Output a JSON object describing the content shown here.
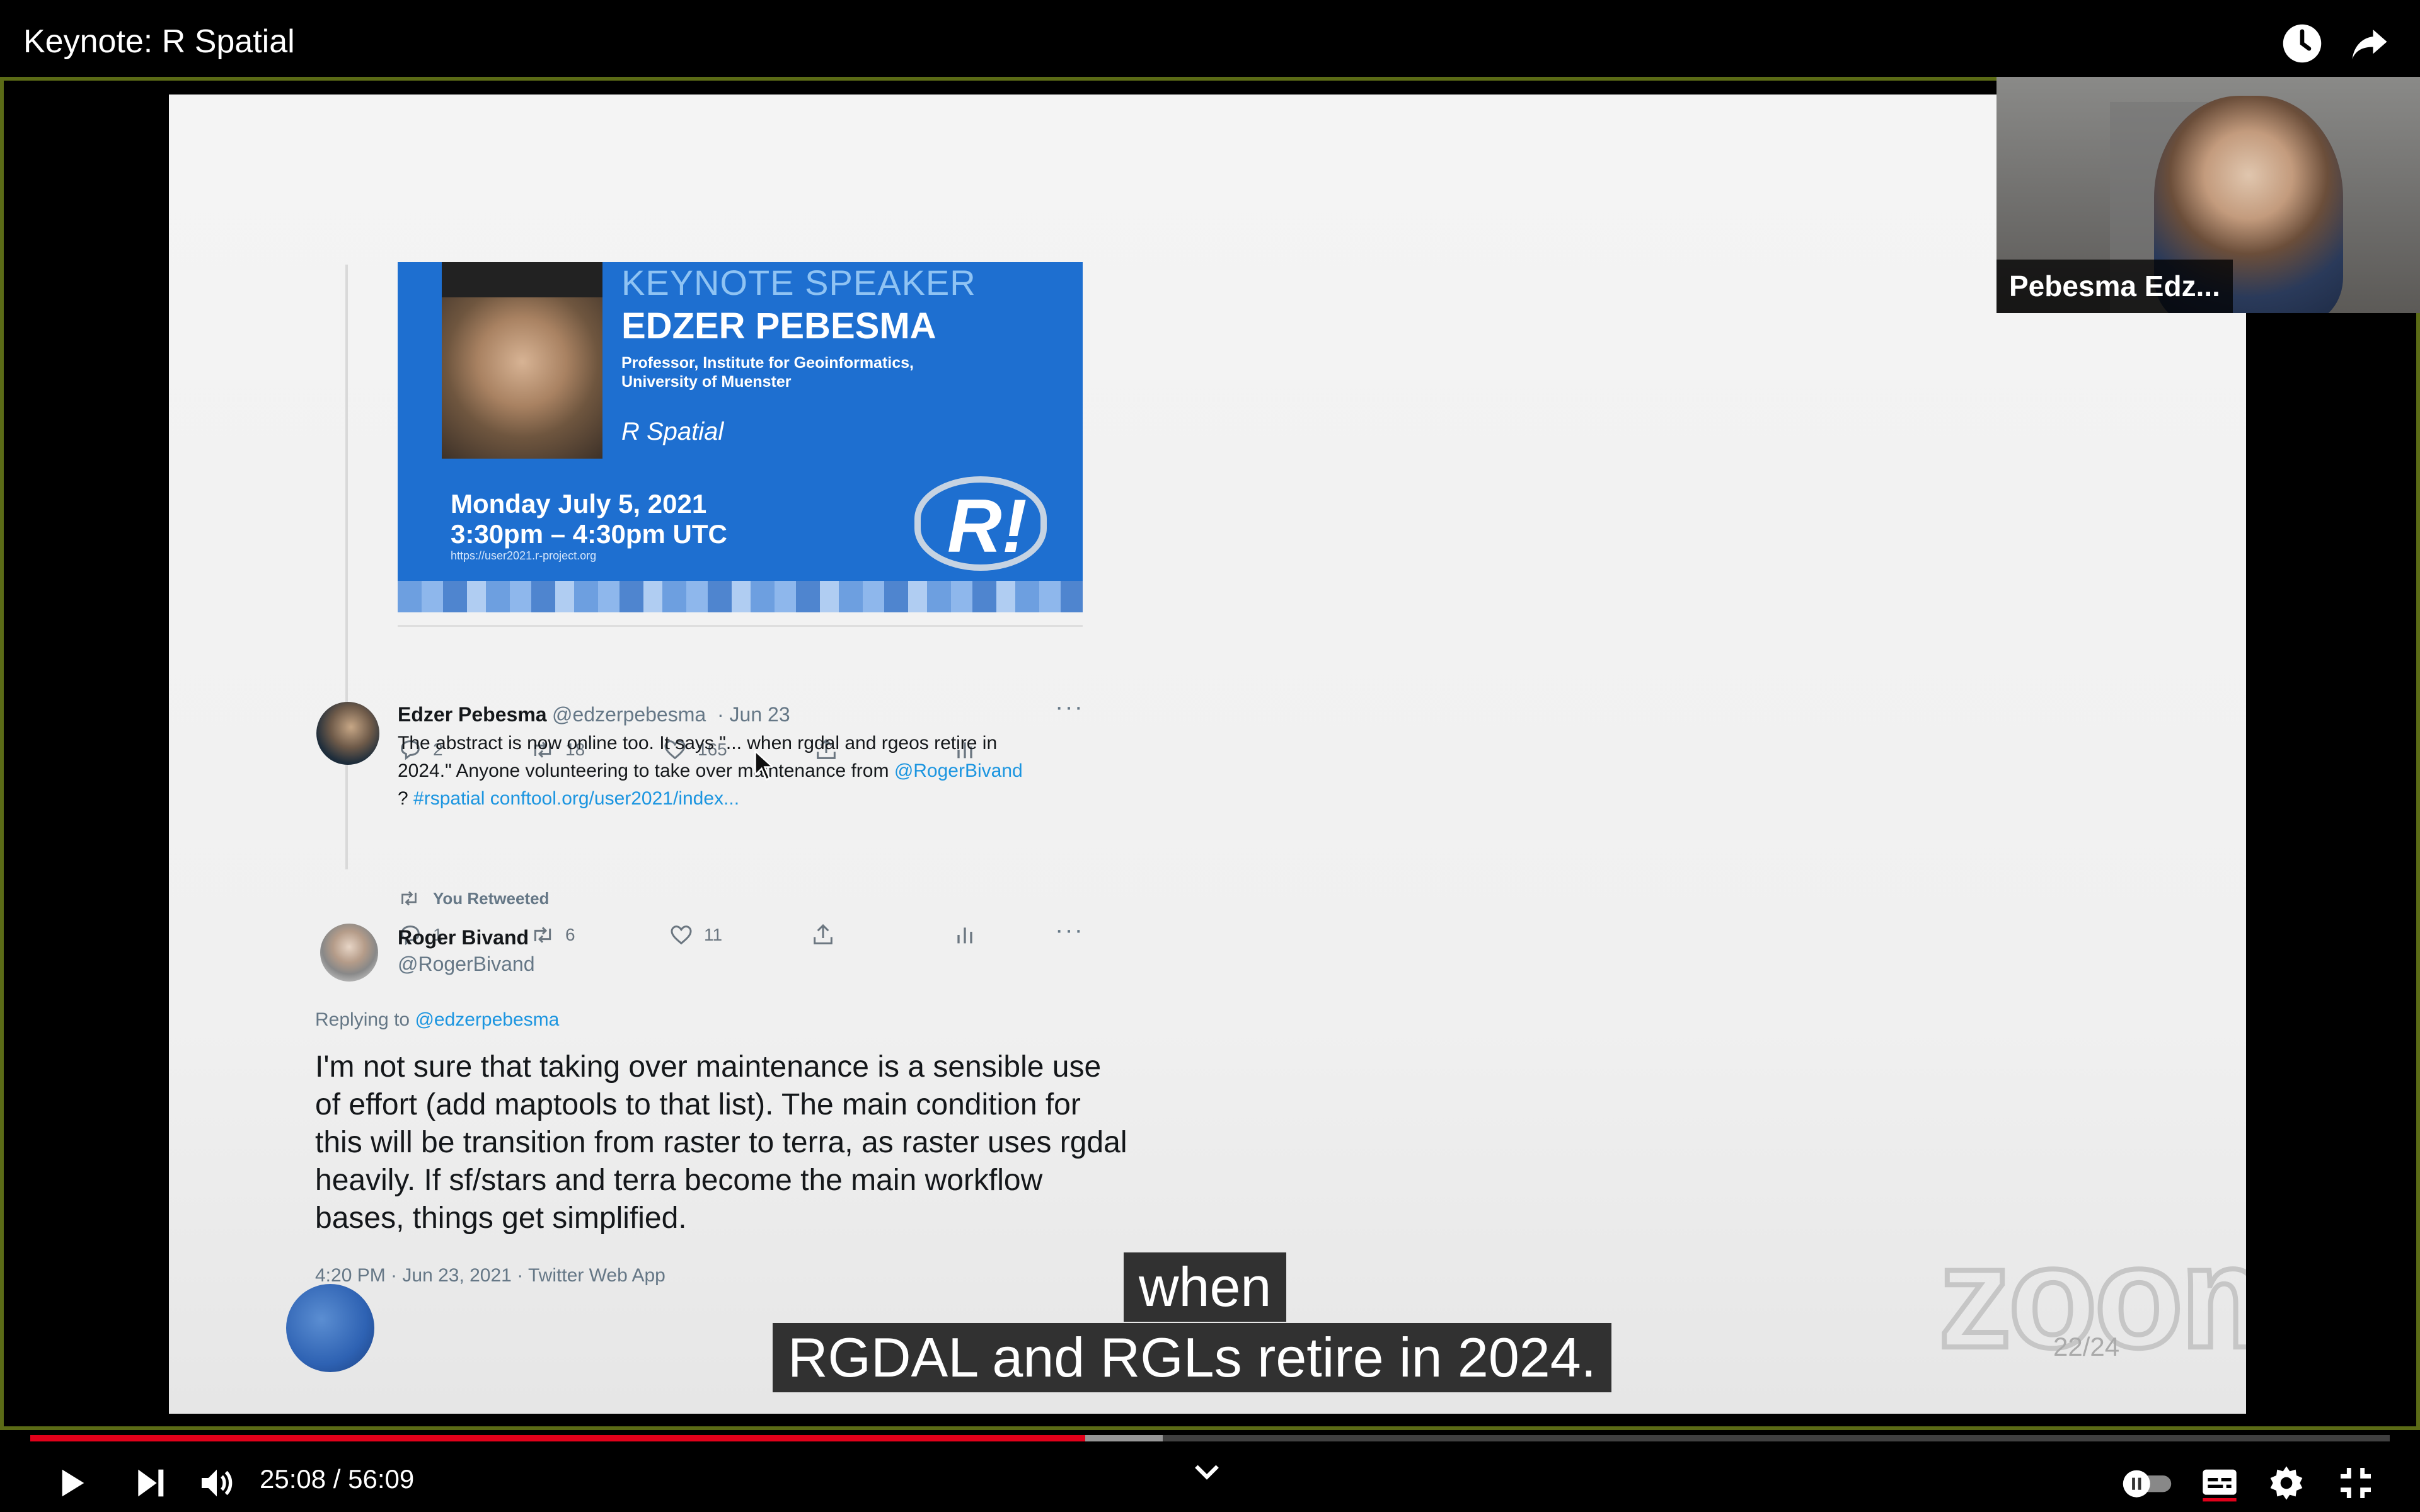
{
  "window": {
    "title": "Keynote: R Spatial"
  },
  "icons": {
    "watch_later": "clock-icon",
    "share": "share-arrow-icon",
    "play": "play-icon",
    "next": "next-icon",
    "volume": "volume-icon",
    "autoplay": "autoplay-toggle-icon",
    "subtitles": "subtitles-icon",
    "settings": "gear-icon",
    "exit_fullscreen": "exit-fullscreen-icon"
  },
  "slide": {
    "banner": {
      "heading": "KEYNOTE SPEAKER",
      "name": "EDZER PEBESMA",
      "role": "Professor, Institute for Geoinformatics, University of Muenster",
      "topic": "R Spatial",
      "date_line1": "Monday July 5, 2021",
      "date_line2": "3:30pm – 4:30pm UTC",
      "url": "https://user2021.r-project.org",
      "logo_text": "R!"
    },
    "tweet1_actions": {
      "replies": "2",
      "retweets": "18",
      "likes": "165"
    },
    "tweet2": {
      "name": "Edzer Pebesma",
      "handle": "@edzerpebesma",
      "date": "· Jun 23",
      "text_line1": "The abstract is now online too. It says \"... when rgdal and rgeos retire in",
      "text_line2_prefix": "2024.\" Anyone volunteering to take over maintenance from ",
      "mention": "@RogerBivand",
      "text_line3_prefix": "? ",
      "hashtag": "#rspatial",
      "link": "conftool.org/user2021/index...",
      "replies": "1",
      "retweets": "6",
      "likes": "11"
    },
    "you_retweeted": "You Retweeted",
    "tweet3": {
      "name": "Roger Bivand",
      "handle": "@RogerBivand",
      "replying_label": "Replying to ",
      "replying_to": "@edzerpebesma",
      "text": "I'm not sure that taking over maintenance is a sensible use of effort (add maptools to that list). The main condition for this will be transition from raster to terra, as raster uses rgdal heavily. If sf/stars and terra become the main workflow bases, things get simplified.",
      "time": "4:20 PM · Jun 23, 2021 · Twitter Web App"
    },
    "zoom_logo": "zoom",
    "page_count": "22/24"
  },
  "participant": {
    "name": "Pebesma  Edz..."
  },
  "captions": {
    "line1": "when",
    "line2": "RGDAL and RGLs retire in 2024."
  },
  "player": {
    "time": "25:08 / 56:09",
    "progress_played": 0.447,
    "progress_loaded": 0.48,
    "accent": "#e1001a"
  }
}
